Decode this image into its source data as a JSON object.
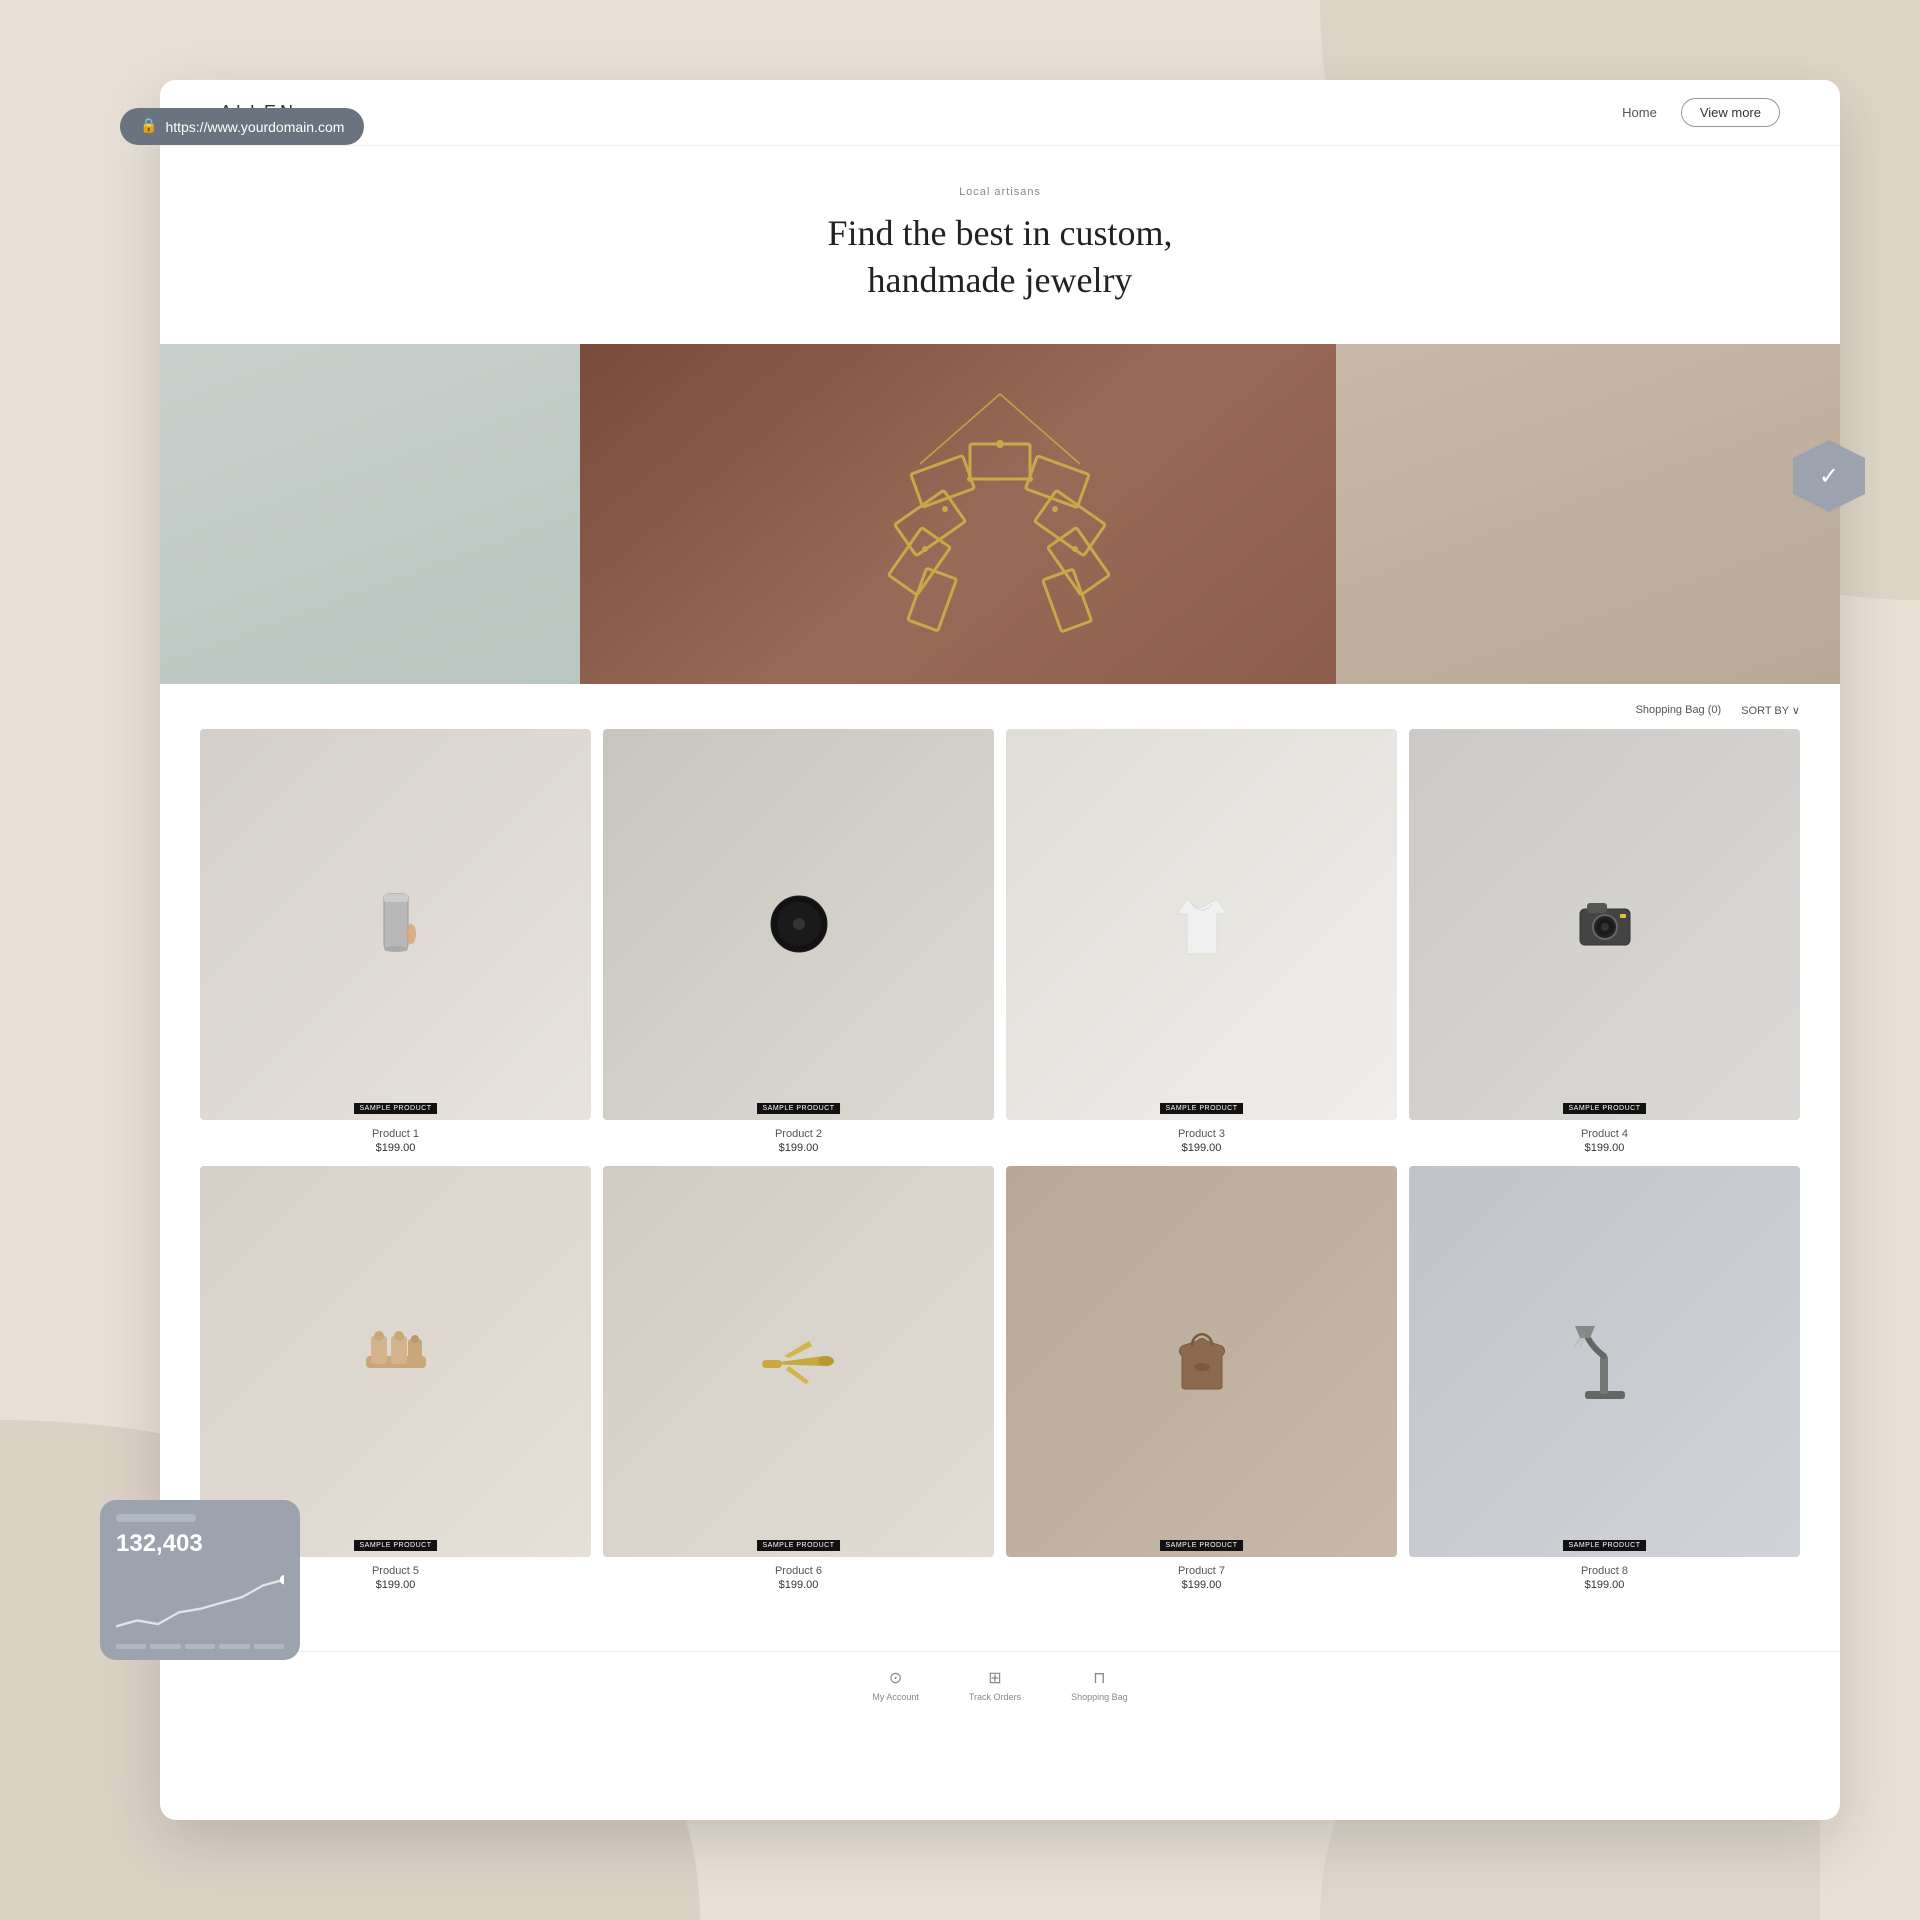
{
  "background": {
    "color": "#e8e0d5"
  },
  "urlBar": {
    "url": "https://www.yourdomain.com",
    "icon": "🔒"
  },
  "securityBadge": {
    "icon": "✓"
  },
  "statsWidget": {
    "number": "132,403",
    "topBar": ""
  },
  "nav": {
    "logo": "ALLEN",
    "homeLabel": "Home",
    "viewMoreLabel": "View more"
  },
  "hero": {
    "subtitle": "Local artisans",
    "title": "Find the best in custom,\nhandmade jewelry"
  },
  "products": {
    "shoppingBagLabel": "Shopping Bag (0)",
    "sortByLabel": "SORT BY ∨",
    "badgeLabel": "SAMPLE PRODUCT",
    "items": [
      {
        "id": 1,
        "name": "Product 1",
        "price": "$199.00"
      },
      {
        "id": 2,
        "name": "Product 2",
        "price": "$199.00"
      },
      {
        "id": 3,
        "name": "Product 3",
        "price": "$199.00"
      },
      {
        "id": 4,
        "name": "Product 4",
        "price": "$199.00"
      },
      {
        "id": 5,
        "name": "Product 5",
        "price": "$199.00"
      },
      {
        "id": 6,
        "name": "Product 6",
        "price": "$199.00"
      },
      {
        "id": 7,
        "name": "Product 7",
        "price": "$199.00"
      },
      {
        "id": 8,
        "name": "Product 8",
        "price": "$199.00"
      }
    ]
  },
  "footer": {
    "items": [
      {
        "label": "My Account",
        "icon": "👤"
      },
      {
        "label": "Track Orders",
        "icon": "📦"
      },
      {
        "label": "Shopping Bag",
        "icon": "🛍"
      }
    ]
  }
}
